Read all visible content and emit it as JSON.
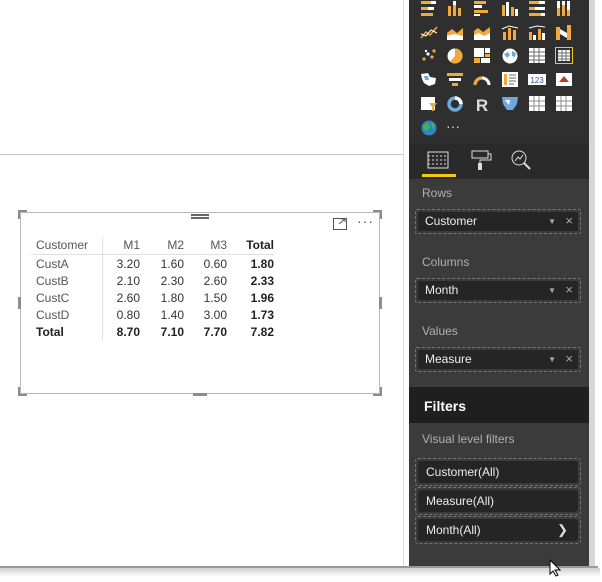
{
  "visual": {
    "table": {
      "row_header": "Customer",
      "columns": [
        "M1",
        "M2",
        "M3",
        "Total"
      ],
      "rows": [
        {
          "label": "CustA",
          "values": [
            "3.20",
            "1.60",
            "0.60",
            "1.80"
          ]
        },
        {
          "label": "CustB",
          "values": [
            "2.10",
            "2.30",
            "2.60",
            "2.33"
          ]
        },
        {
          "label": "CustC",
          "values": [
            "2.60",
            "1.80",
            "1.50",
            "1.96"
          ]
        },
        {
          "label": "CustD",
          "values": [
            "0.80",
            "1.40",
            "3.00",
            "1.73"
          ]
        }
      ],
      "total_row": {
        "label": "Total",
        "values": [
          "8.70",
          "7.10",
          "7.70",
          "7.82"
        ]
      }
    },
    "header_icons": [
      "focus-mode-icon",
      "more-options-icon"
    ]
  },
  "gallery": {
    "icons": [
      "stacked-bar-icon",
      "stacked-column-icon",
      "clustered-bar-icon",
      "clustered-column-icon",
      "100-stacked-bar-icon",
      "100-stacked-column-icon",
      "line-chart-icon",
      "area-chart-icon",
      "stacked-area-icon",
      "line-column-icon",
      "line-clustered-column-icon",
      "ribbon-chart-icon",
      "scatter-chart-icon",
      "pie-chart-icon",
      "treemap-icon",
      "map-icon",
      "table-icon",
      "matrix-icon",
      "filled-map-icon",
      "funnel-icon",
      "gauge-icon",
      "multi-row-card-icon",
      "card-icon",
      "kpi-icon",
      "slicer-icon",
      "donut-icon",
      "r-script-icon",
      "shape-map-icon",
      "table-visual-icon",
      "matrix-visual-icon",
      "globe-icon",
      "more-visuals-icon"
    ],
    "selected": "matrix-icon"
  },
  "tabs": [
    "fields-tab",
    "format-tab",
    "analytics-tab"
  ],
  "wells": {
    "rows_label": "Rows",
    "rows_value": "Customer",
    "columns_label": "Columns",
    "columns_value": "Month",
    "values_label": "Values",
    "values_value": "Measure"
  },
  "filters": {
    "title": "Filters",
    "visual_level_label": "Visual level filters",
    "items": [
      "Customer(All)",
      "Measure(All)",
      "Month(All)"
    ]
  },
  "colors": {
    "accent": "#f2c811",
    "pane_bg": "#3b3b3b",
    "gallery_bg": "#2f2f2f"
  }
}
